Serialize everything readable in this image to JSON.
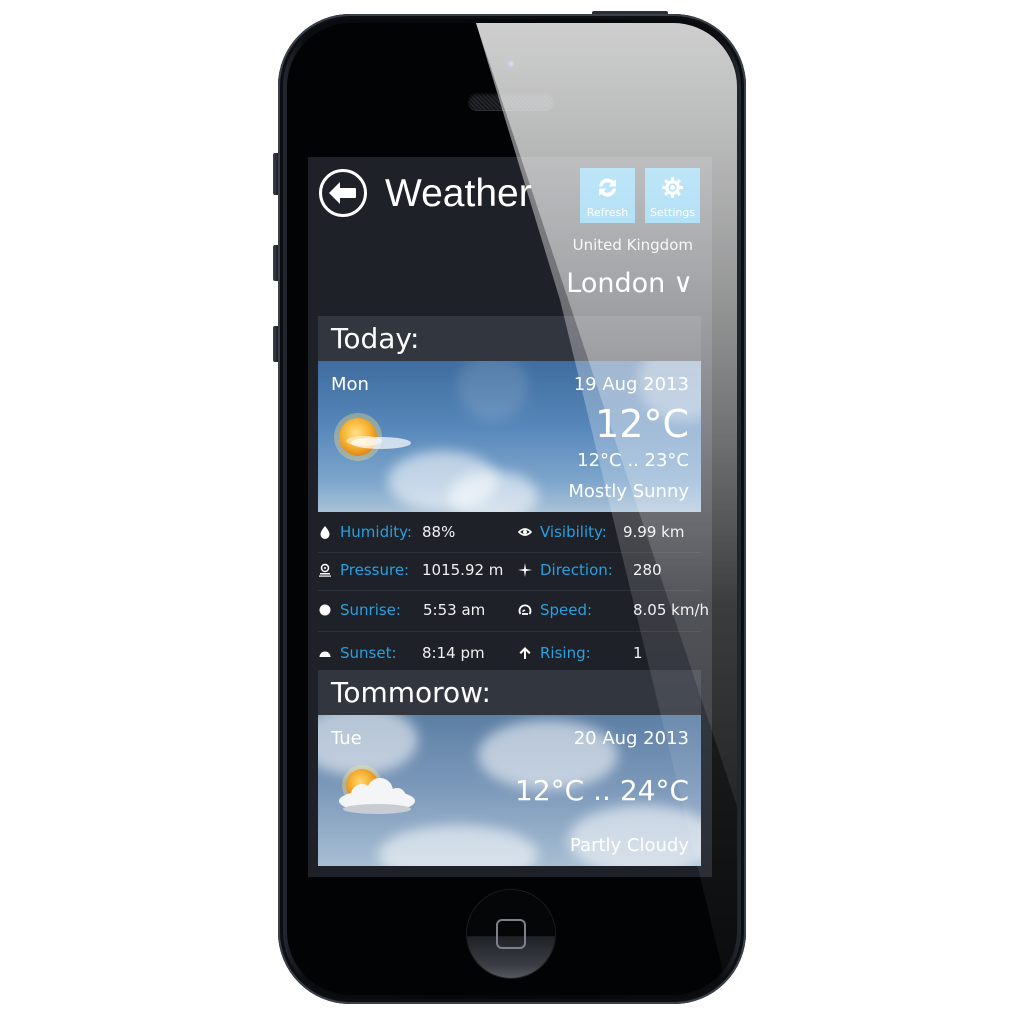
{
  "app": {
    "title": "Weather",
    "back_icon": "back-arrow-circle-icon"
  },
  "toolbar": {
    "refresh_label": "Refresh",
    "refresh_icon": "refresh-icon",
    "settings_label": "Settings",
    "settings_icon": "gear-icon"
  },
  "location": {
    "country": "United Kingdom",
    "city": "London",
    "city_dropdown_icon": "chevron-down-icon",
    "chevron": "∨"
  },
  "colors": {
    "accent": "#27a9e6",
    "label_blue": "#2a9fe0",
    "screen_bg": "#1e2128",
    "section_header_bg": "#32363f"
  },
  "today": {
    "section_label": "Today:",
    "day": "Mon",
    "date": "19 Aug 2013",
    "current_temp": "12°C",
    "range": "12°C .. 23°C",
    "condition": "Mostly Sunny",
    "icon": "sun-with-cloud-icon"
  },
  "stats": [
    [
      {
        "icon": "droplet-icon",
        "label": "Humidity:",
        "value": "88%"
      },
      {
        "icon": "eye-icon",
        "label": "Visibility:",
        "value": "9.99 km"
      }
    ],
    [
      {
        "icon": "pressure-gauge-icon",
        "label": "Pressure:",
        "value": "1015.92 m"
      },
      {
        "icon": "compass-star-icon",
        "label": "Direction:",
        "value": "280"
      }
    ],
    [
      {
        "icon": "sunrise-icon",
        "label": "Sunrise:",
        "value": "5:53 am"
      },
      {
        "icon": "speedometer-icon",
        "label": "Speed:",
        "value": "8.05 km/h"
      }
    ],
    [
      {
        "icon": "sunset-icon",
        "label": "Sunset:",
        "value": "8:14 pm"
      },
      {
        "icon": "arrow-up-icon",
        "label": "Rising:",
        "value": "1"
      }
    ]
  ],
  "tomorrow": {
    "section_label": "Tommorow:",
    "day": "Tue",
    "date": "20 Aug 2013",
    "range": "12°C .. 24°C",
    "condition": "Partly Cloudy",
    "icon": "partly-cloudy-icon"
  }
}
